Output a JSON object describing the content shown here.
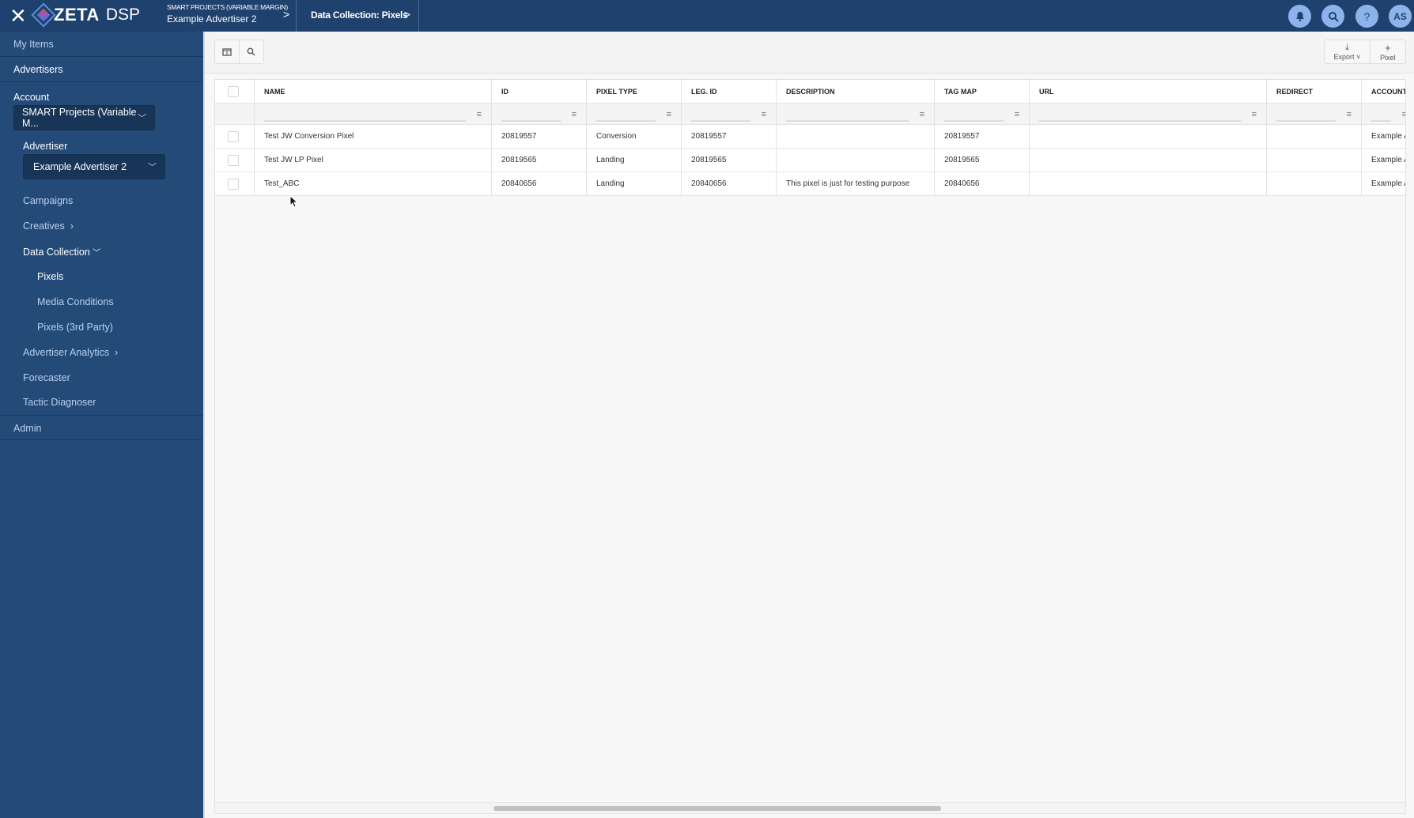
{
  "topbar": {
    "close_icon": "close-icon",
    "logo_text": "ZETA",
    "logo_suffix": "DSP",
    "breadcrumb": [
      {
        "sub": "SMART PROJECTS (VARIABLE MARGIN)",
        "label": "Example Advertiser 2"
      },
      {
        "label": "Data Collection: Pixels"
      }
    ],
    "icons": [
      "bell-icon",
      "search-icon",
      "help-icon"
    ],
    "help": "?",
    "avatar": "AS"
  },
  "sidebar": {
    "my_items": "My Items",
    "advertisers": "Advertisers",
    "account_label": "Account",
    "account_value": "SMART Projects (Variable M...",
    "advertiser_label": "Advertiser",
    "advertiser_value": "Example Advertiser 2",
    "items": [
      "Campaigns",
      "Creatives",
      "Data Collection",
      "Pixels",
      "Media Conditions",
      "Pixels (3rd Party)",
      "Advertiser Analytics",
      "Forecaster",
      "Tactic Diagnoser"
    ],
    "admin": "Admin"
  },
  "toolbar": {
    "export": "Export",
    "pixel": "Pixel"
  },
  "table": {
    "columns": [
      "NAME",
      "ID",
      "PIXEL TYPE",
      "LEG. ID",
      "DESCRIPTION",
      "TAG MAP",
      "URL",
      "REDIRECT",
      "ACCOUNT"
    ],
    "rows": [
      [
        "Test JW Conversion Pixel",
        "20819557",
        "Conversion",
        "20819557",
        "",
        "20819557",
        "",
        "",
        "Example A"
      ],
      [
        "Test JW LP Pixel",
        "20819565",
        "Landing",
        "20819565",
        "",
        "20819565",
        "",
        "",
        "Example A"
      ],
      [
        "Test_ABC",
        "20840656",
        "Landing",
        "20840656",
        "This pixel is just for testing purpose",
        "20840656",
        "",
        "",
        "Example A"
      ]
    ]
  },
  "colors": {
    "topbar": "#1f416d",
    "sidebar": "#244a78",
    "avatar": "#8db3ec"
  }
}
